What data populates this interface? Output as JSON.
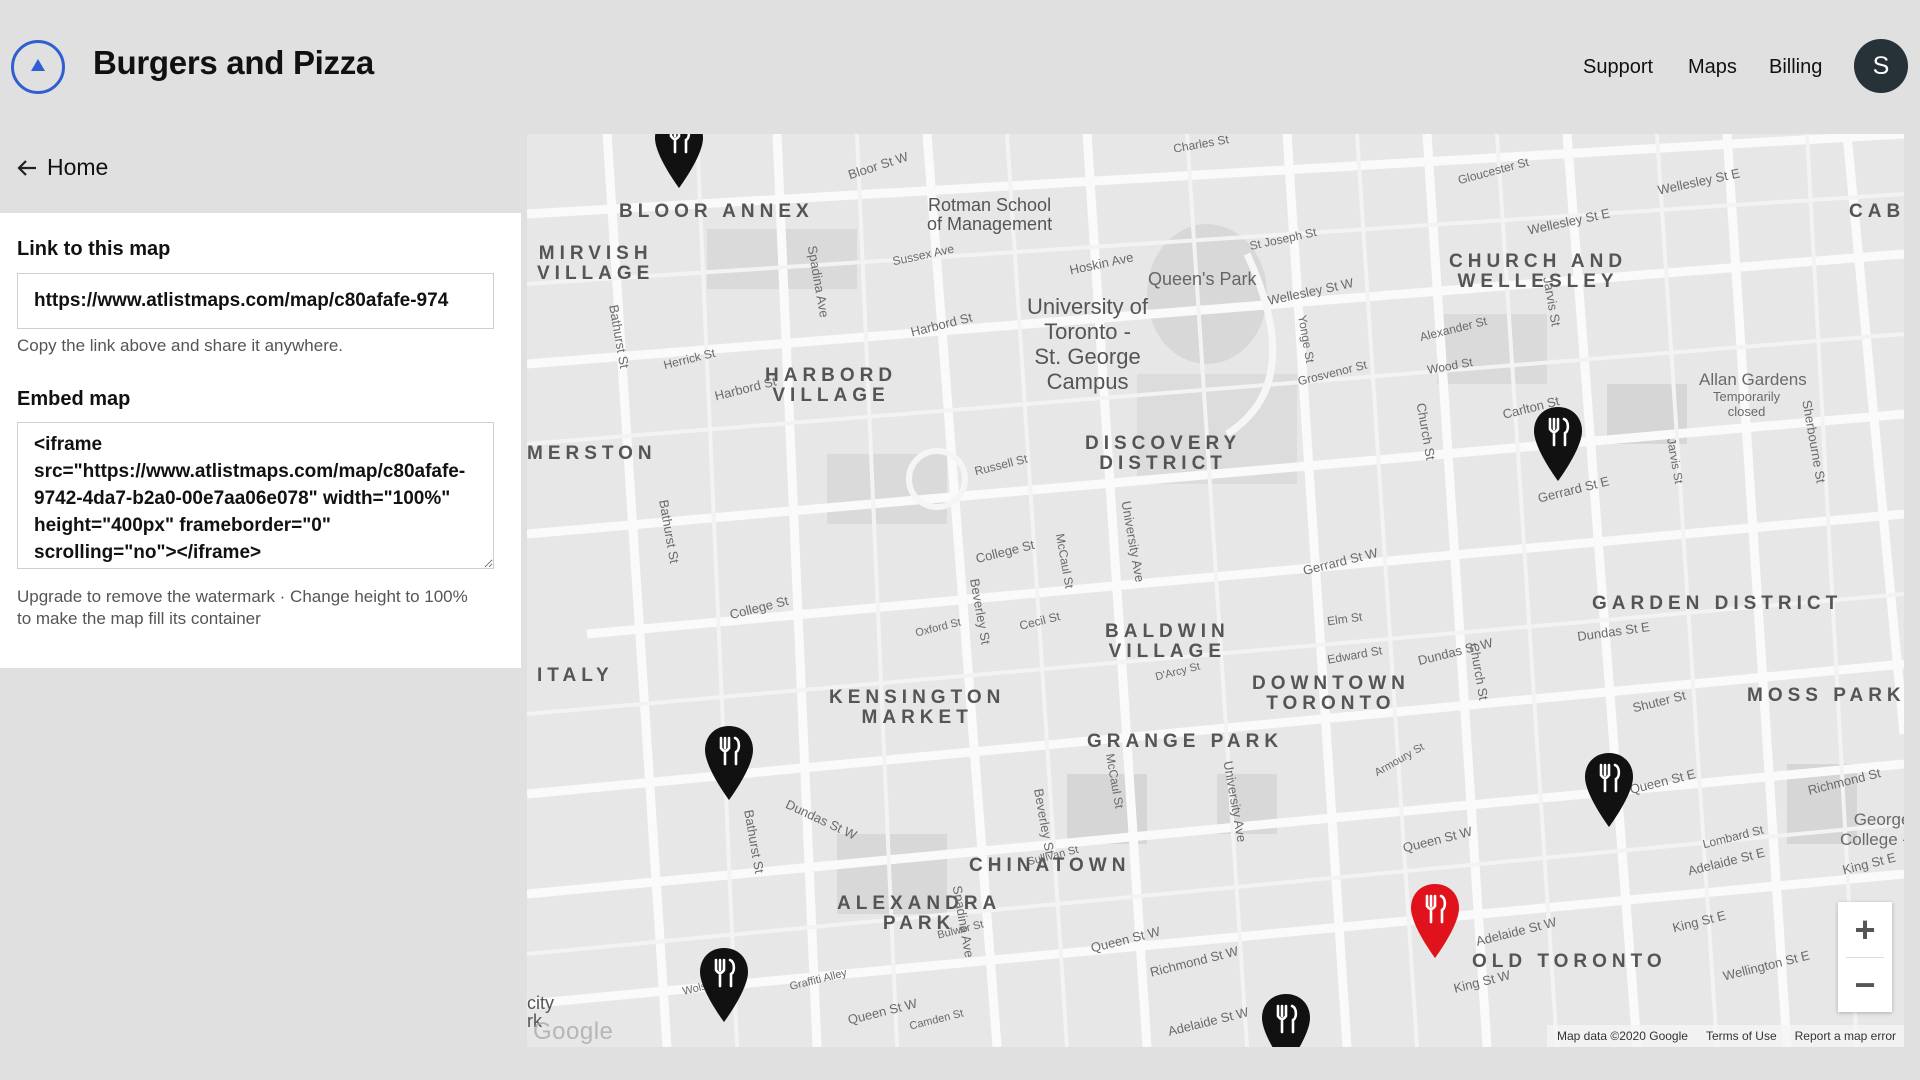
{
  "header": {
    "title": "Burgers and Pizza",
    "nav": [
      "Support",
      "Maps",
      "Billing"
    ],
    "avatar_initial": "S"
  },
  "sidebar": {
    "home_label": "Home",
    "link_label": "Link to this map",
    "link_value": "https://www.atlistmaps.com/map/c80afafe-974",
    "link_help": "Copy the link above and share it anywhere.",
    "embed_label": "Embed map",
    "embed_value": "<iframe src=\"https://www.atlistmaps.com/map/c80afafe-9742-4da7-b2a0-00e7aa06e078\" width=\"100%\" height=\"400px\" frameborder=\"0\" scrolling=\"no\"></iframe>",
    "embed_help": "Upgrade to remove the watermark · Change height to 100% to make the map fill its container"
  },
  "map": {
    "districts": [
      "BLOOR ANNEX",
      "MIRVISH\nVILLAGE",
      "HARBORD\nVILLAGE",
      "CHURCH AND\nWELLESLEY",
      "DISCOVERY\nDISTRICT",
      "MERSTON",
      "GARDEN DISTRICT",
      "BALDWIN\nVILLAGE",
      "DOWNTOWN\nTORONTO",
      "KENSINGTON\nMARKET",
      "GRANGE PARK",
      "ITALY",
      "MOSS PARK",
      "CHINATOWN",
      "ALEXANDRA\nPARK",
      "OLD TORONTO",
      "CAB"
    ],
    "places": [
      "Rotman School\nof Management",
      "Queen's Park",
      "University of\nToronto -\nSt. George\nCampus",
      "Allan Gardens",
      "Temporarily\nclosed",
      "George\nCollege - S"
    ],
    "streets": [
      "Bloor St W",
      "Charles St",
      "Gloucester St",
      "Wellesley St E",
      "Sussex Ave",
      "Hoskin Ave",
      "St Joseph St",
      "Wellesley St W",
      "Harbord St",
      "Herrick St",
      "Alexander St",
      "Wood St",
      "Grosvenor St",
      "Carlton St",
      "Gerrard St E",
      "Russell St",
      "College St",
      "Gerrard St W",
      "Elm St",
      "Edward St",
      "Dundas St W",
      "Dundas St E",
      "Oxford St",
      "Cecil St",
      "D'Arcy St",
      "Shuter St",
      "Queen St E",
      "Queen St W",
      "Richmond St W",
      "Adelaide St W",
      "Adelaide St E",
      "King St E",
      "King St W",
      "Lombard St",
      "Wellington St E",
      "Bathurst St",
      "Spadina Ave",
      "University Ave",
      "Yonge St",
      "Church St",
      "Jarvis St",
      "Sherbourne St",
      "Beverley St",
      "McCaul St",
      "Wolseley St",
      "Camden St",
      "Bulwer St",
      "Graffiti Alley",
      "Sullivan St",
      "Armoury St",
      "Richmond St"
    ],
    "zoom_in": "+",
    "zoom_out": "−",
    "watermark": "Google",
    "edge_text": "city\nrk",
    "attribution": [
      "Map data ©2020 Google",
      "Terms of Use",
      "Report a map error"
    ],
    "pin_colors": {
      "default": "#111111",
      "selected": "#e0131c"
    }
  }
}
